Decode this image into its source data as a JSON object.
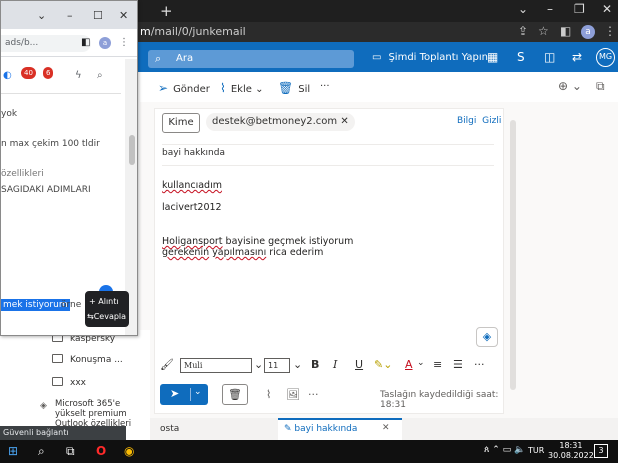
{
  "browser": {
    "url_prefix": "m/mail/0/junkemail",
    "url_domain": "m",
    "url_path": "/mail/0/junkemail",
    "new_tab": "+",
    "profile_initial": "a"
  },
  "outlook": {
    "search_placeholder": "Ara",
    "meet_now": "Şimdi Toplantı Yapın",
    "avatar_initials": "MG",
    "toolbar": {
      "send": "Gönder",
      "attach": "Ekle",
      "delete": "Sil",
      "more": "···"
    },
    "compose": {
      "to_label": "Kime",
      "recipient": "destek@betmoney2.com",
      "cc": "Bilgi",
      "bcc": "Gizli",
      "subject": "bayi hakkında",
      "body": {
        "line1": "kullancıadım",
        "line2": "lacivert2012",
        "line3a": "Holigansport",
        "line3b": " bayisine geçmek istiyorum",
        "line4a": "gerekenin",
        "line4b": "  ",
        "line4c": "yapılmasını",
        "line4d": " rica ederim"
      },
      "font_name": "Muli",
      "font_size": "11",
      "draft_saved": "Taslağın kaydedildiği saat: 18:31"
    },
    "tabs": {
      "mail": "osta",
      "draft": "bayi hakkında"
    },
    "folders": [
      "kaspersky",
      "Konuşma ...",
      "xxx"
    ],
    "promo": [
      "Microsoft 365'e",
      "yükselt premium",
      "Outlook özellikleri"
    ]
  },
  "popup": {
    "url": "ads/b...",
    "badges": [
      "40",
      "6"
    ],
    "lines": {
      "l1": "yok",
      "l2": "n max çekim 100 tldir",
      "l3": "özellikleri",
      "l4": "SAGIDAKI ADIMLARI",
      "highlight": "mek istiyorum",
      "after": "örne"
    },
    "context": {
      "quote": "+ Alıntı",
      "reply": "Cevapla"
    }
  },
  "status_tip": "Güvenli bağlantı oluşturuluyor...",
  "taskbar": {
    "language": "TUR",
    "time": "18:31",
    "date": "30.08.2022",
    "notifications": "3"
  }
}
